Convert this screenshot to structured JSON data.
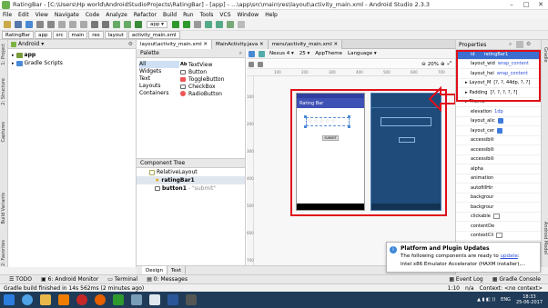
{
  "window": {
    "title": "RatingBar - [C:\\Users\\Hp world\\AndroidStudioProjects\\RatingBar] - [app] - ...\\app\\src\\main\\res\\layout\\activity_main.xml - Android Studio 2.3.3"
  },
  "menu": [
    "File",
    "Edit",
    "View",
    "Navigate",
    "Code",
    "Analyze",
    "Refactor",
    "Build",
    "Run",
    "Tools",
    "VCS",
    "Window",
    "Help"
  ],
  "toolbar": {
    "run_config": "app"
  },
  "breadcrumb": [
    "RatingBar",
    "app",
    "src",
    "main",
    "res",
    "layout",
    "activity_main.xml"
  ],
  "project": {
    "view": "Android",
    "items": [
      "app",
      "Gradle Scripts"
    ]
  },
  "side_labels": {
    "left": [
      "1: Project",
      "2: Structure",
      "Captures",
      "Build Variants",
      "2: Favorites"
    ],
    "right": [
      "Gradle",
      "Android Model"
    ]
  },
  "editor": {
    "tabs": [
      "layout\\activity_main.xml",
      "MainActivity.java",
      "menu\\activity_main.xml"
    ],
    "palette": {
      "title": "Palette",
      "categories": [
        "All",
        "Widgets",
        "Text",
        "Layouts",
        "Containers"
      ],
      "items": [
        "TextView",
        "Button",
        "ToggleButton",
        "CheckBox",
        "RadioButton"
      ]
    },
    "design_toolbar": {
      "device": "Nexus 4",
      "api": "25",
      "theme": "AppTheme",
      "language": "Language",
      "zoom": "20%"
    },
    "component_tree": {
      "title": "Component Tree",
      "root": "RelativeLayout",
      "children": [
        {
          "name": "ratingBar1",
          "extra": ""
        },
        {
          "name": "button1",
          "extra": "- \"submit\""
        }
      ]
    },
    "preview": {
      "app_title": "Rating Bar",
      "button_label": "SUBMIT"
    },
    "ruler": [
      "100",
      "200",
      "300",
      "400",
      "500",
      "600",
      "700"
    ],
    "bottom_tabs": [
      "Design",
      "Text"
    ]
  },
  "properties": {
    "title": "Properties",
    "rows": [
      {
        "name": "id",
        "value": "ratingBar1"
      },
      {
        "name": "layout_wid",
        "value": "wrap_content"
      },
      {
        "name": "layout_hei",
        "value": "wrap_content"
      },
      {
        "name": "Layout_M",
        "value": "[?, ?, 44dp, ?, ?]"
      },
      {
        "name": "Padding",
        "value": "[?, ?, ?, ?, ?]"
      },
      {
        "name": "Theme",
        "value": ""
      },
      {
        "name": "elevation",
        "value": "1dp"
      },
      {
        "name": "layout_alic",
        "value": ""
      },
      {
        "name": "layout_cer",
        "value": ""
      },
      {
        "name": "accessibili",
        "value": ""
      },
      {
        "name": "accessibili",
        "value": ""
      },
      {
        "name": "accessibili",
        "value": ""
      },
      {
        "name": "alpha",
        "value": ""
      },
      {
        "name": "animation",
        "value": ""
      },
      {
        "name": "autofillHir",
        "value": ""
      },
      {
        "name": "backgrour",
        "value": ""
      },
      {
        "name": "backgrour",
        "value": ""
      },
      {
        "name": "clickable",
        "value": ""
      },
      {
        "name": "contentDe",
        "value": ""
      },
      {
        "name": "contextCli",
        "value": ""
      }
    ]
  },
  "notification": {
    "title": "Platform and Plugin Updates",
    "body": "The following components are ready to",
    "link": "update",
    "body2": "Intel x86 Emulator Accelerator (HAXM installer),..."
  },
  "tool_tabs": {
    "left": [
      "TODO",
      "6: Android Monitor",
      "Terminal",
      "0: Messages"
    ],
    "right": [
      "Event Log",
      "Gradle Console"
    ]
  },
  "status": {
    "message": "Gradle build finished in 14s 562ms (2 minutes ago)",
    "position": "1:10",
    "encoding": "n/a",
    "context": "Context: <no context>"
  },
  "taskbar": {
    "language": "ENG",
    "time": "18:33",
    "date": "25-06-2017"
  }
}
